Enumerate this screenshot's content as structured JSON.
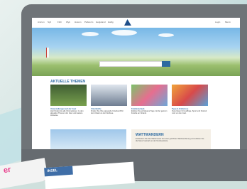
{
  "navigation": {
    "items": [
      "Amrum",
      "Sylt",
      "Föhr",
      "Wyk",
      "Husum",
      "Pellworm",
      "Helgoland",
      "Hallig"
    ],
    "right": [
      "Login",
      "Menü"
    ]
  },
  "section": {
    "title": "AKTUELLE THEMEN"
  },
  "cards": [
    {
      "highlight": "Veranstaltungen auf der Insel",
      "text": "Hier findest du alle Informationen zu den aktuellen Themen der Insel und weitere Hinweise."
    },
    {
      "highlight": "Unterkünfte",
      "text": "Finden Sie Ihre passende Unterkunft für den Urlaub an der Nordsee."
    },
    {
      "highlight": "Familienurlaub",
      "text": "Erleben Sie erholsame Tage mit der ganzen Familie am Strand."
    },
    {
      "highlight": "Tipps & Erlebnisse",
      "text": "Viele Ideen für Ausflüge, Sport und Freizeit rund um die Insel."
    }
  ],
  "info": {
    "title": "WATTWANDERN",
    "text": "Entdecken Sie das Wattenmeer bei einer geführten Wattwanderung und erleben Sie die Natur hautnah an der Nordseeküste."
  },
  "brochure": {
    "front_text": "er",
    "logo": "INSEL"
  }
}
